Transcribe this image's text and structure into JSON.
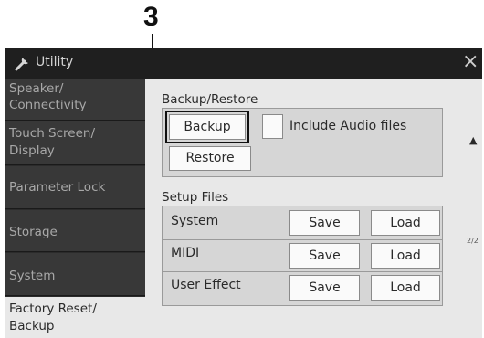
{
  "callout": {
    "number": "3"
  },
  "titlebar": {
    "title": "Utility",
    "close_glyph": "×",
    "icon": "wrench-icon"
  },
  "sidebar": {
    "items": [
      {
        "line1": "Speaker/",
        "line2": "Connectivity",
        "active": false
      },
      {
        "line1": "Touch Screen/",
        "line2": "Display",
        "active": false
      },
      {
        "line1": "Parameter Lock",
        "line2": "",
        "active": false
      },
      {
        "line1": "Storage",
        "line2": "",
        "active": false
      },
      {
        "line1": "System",
        "line2": "",
        "active": false
      },
      {
        "line1": "Factory Reset/",
        "line2": "Backup",
        "active": true
      }
    ]
  },
  "backup_restore": {
    "label": "Backup/Restore",
    "backup_button": "Backup",
    "include_audio_label": "Include Audio files",
    "include_audio_checked": false,
    "restore_button": "Restore"
  },
  "setup_files": {
    "label": "Setup Files",
    "rows": [
      {
        "name": "System",
        "save": "Save",
        "load": "Load"
      },
      {
        "name": "MIDI",
        "save": "Save",
        "load": "Load"
      },
      {
        "name": "User Effect",
        "save": "Save",
        "load": "Load"
      }
    ]
  },
  "scroll": {
    "up_glyph": "▲",
    "page_indicator": "2/2"
  }
}
